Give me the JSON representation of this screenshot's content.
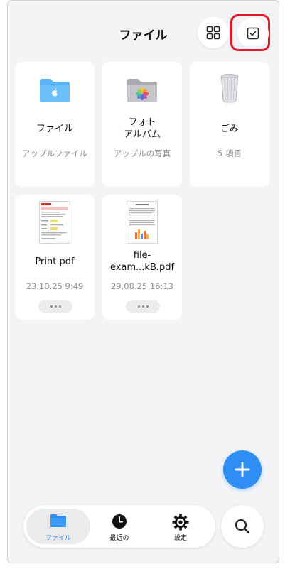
{
  "header": {
    "title": "ファイル"
  },
  "tiles": [
    {
      "name": "ファイル",
      "sub": "アップルファイル",
      "icon": "blue-folder-icon"
    },
    {
      "name": "フォト\nアルバム",
      "sub": "アップルの写真",
      "icon": "photos-folder-icon"
    },
    {
      "name": "ごみ",
      "sub": "5 項目",
      "icon": "trash-icon"
    },
    {
      "name": "Print.pdf",
      "sub": "23.10.25 9:49",
      "icon": "pdf-thumbnail"
    },
    {
      "name": "file-\nexam...kB.pdf",
      "sub": "29.08.25 16:13",
      "icon": "pdf-thumbnail"
    }
  ],
  "tabbar": {
    "tabs": [
      {
        "label": "ファイル",
        "icon": "folder-icon",
        "active": true
      },
      {
        "label": "最近の",
        "icon": "clock-icon",
        "active": false
      },
      {
        "label": "設定",
        "icon": "gear-icon",
        "active": false
      }
    ]
  },
  "colors": {
    "accent": "#2f8ef3",
    "highlight": "#e0192a",
    "background": "#f4f4f6"
  }
}
